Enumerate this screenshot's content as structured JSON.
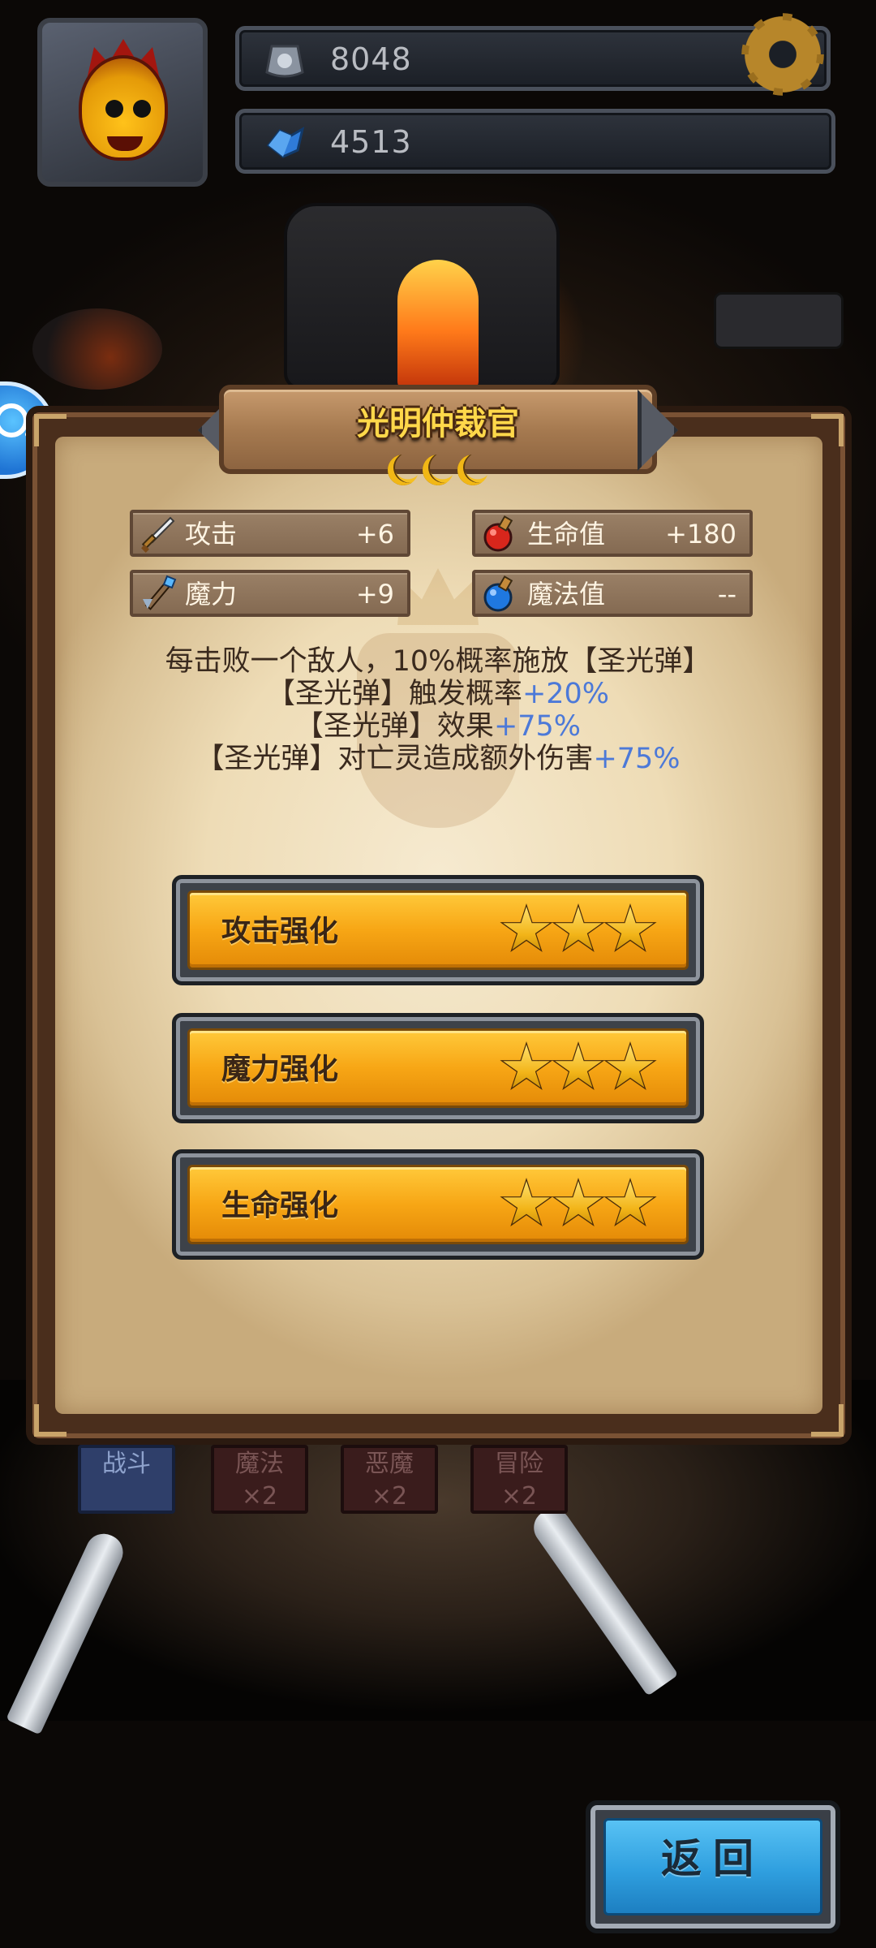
{
  "hud": {
    "gems": "8048",
    "crystals": "4513"
  },
  "panel": {
    "title": "光明仲裁官",
    "rank_moons": 3,
    "stats": [
      {
        "label": "攻击",
        "value": "+6",
        "icon": "sword-icon"
      },
      {
        "label": "生命值",
        "value": "+180",
        "icon": "red-potion-icon"
      },
      {
        "label": "魔力",
        "value": "+9",
        "icon": "magic-wand-icon"
      },
      {
        "label": "魔法值",
        "value": "--",
        "icon": "blue-potion-icon"
      }
    ],
    "description": {
      "line1": "每击败一个敌人，10%概率施放【圣光弹】",
      "line2_text": "【圣光弹】触发概率",
      "line2_value": "+20%",
      "line3_text": "【圣光弹】效果",
      "line3_value": "+75%",
      "line4_text": "【圣光弹】对亡灵造成额外伤害",
      "line4_value": "+75%"
    },
    "upgrades": [
      {
        "label": "攻击强化",
        "stars": 3
      },
      {
        "label": "魔力强化",
        "stars": 3
      },
      {
        "label": "生命强化",
        "stars": 3
      }
    ]
  },
  "background_tabs": [
    "战斗",
    "魔法\n×2",
    "恶魔\n×2",
    "冒险\n×2"
  ],
  "back_button": "返回",
  "colors": {
    "accent_gold": "#ffd84a",
    "highlight_blue": "#4c79d8",
    "button_orange": "#f7a615",
    "button_blue": "#2f9fdf"
  }
}
